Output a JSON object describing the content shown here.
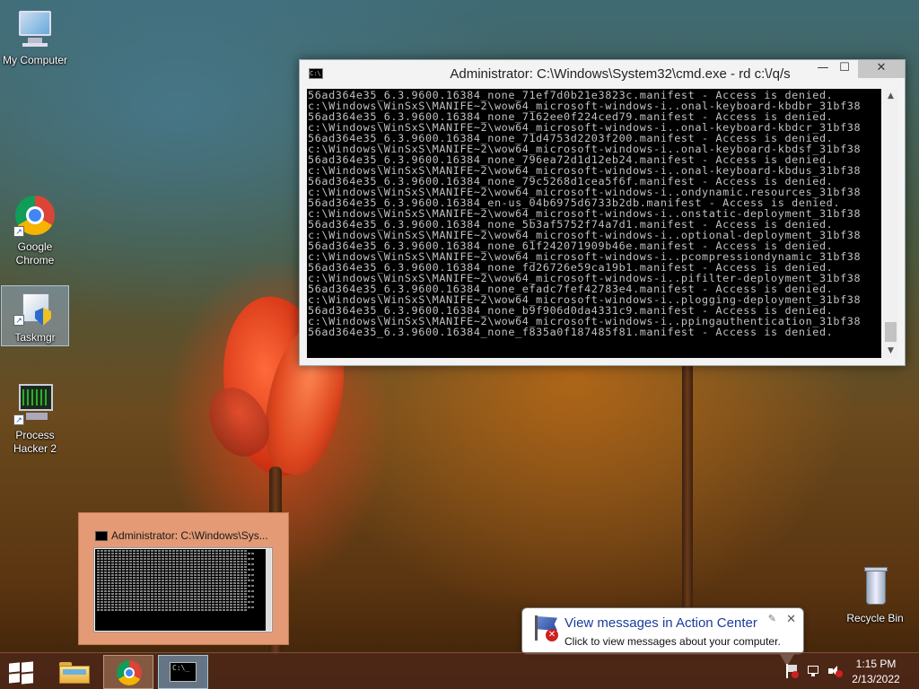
{
  "desktop": {
    "icons": [
      {
        "label": "My Computer",
        "icon": "computer-icon"
      },
      {
        "label": "Google Chrome",
        "icon": "chrome-icon"
      },
      {
        "label": "Taskmgr",
        "icon": "taskmgr-icon"
      },
      {
        "label": "Process Hacker 2",
        "icon": "process-hacker-icon"
      },
      {
        "label": "Recycle Bin",
        "icon": "recycle-bin-icon"
      }
    ]
  },
  "cmd_window": {
    "title": "Administrator: C:\\Windows\\System32\\cmd.exe - rd  c:\\/q/s",
    "minimize": "—",
    "maximize": "☐",
    "close": "✕",
    "lines": [
      "56ad364e35_6.3.9600.16384_none_71ef7d0b21e3823c.manifest - Access is denied.",
      "c:\\Windows\\WinSxS\\MANIFE~2\\wow64_microsoft-windows-i..onal-keyboard-kbdbr_31bf38",
      "56ad364e35_6.3.9600.16384_none_7162ee0f224ced79.manifest - Access is denied.",
      "c:\\Windows\\WinSxS\\MANIFE~2\\wow64_microsoft-windows-i..onal-keyboard-kbdcr_31bf38",
      "56ad364e35_6.3.9600.16384_none_71d4753d2203f200.manifest - Access is denied.",
      "c:\\Windows\\WinSxS\\MANIFE~2\\wow64_microsoft-windows-i..onal-keyboard-kbdsf_31bf38",
      "56ad364e35_6.3.9600.16384_none_796ea72d1d12eb24.manifest - Access is denied.",
      "c:\\Windows\\WinSxS\\MANIFE~2\\wow64_microsoft-windows-i..onal-keyboard-kbdus_31bf38",
      "56ad364e35_6.3.9600.16384_none_79c5268d1cea5f6f.manifest - Access is denied.",
      "c:\\Windows\\WinSxS\\MANIFE~2\\wow64_microsoft-windows-i..ondynamic.resources_31bf38",
      "56ad364e35_6.3.9600.16384_en-us_04b6975d6733b2db.manifest - Access is denied.",
      "c:\\Windows\\WinSxS\\MANIFE~2\\wow64_microsoft-windows-i..onstatic-deployment_31bf38",
      "56ad364e35_6.3.9600.16384_none_5b3af5752f74a7d1.manifest - Access is denied.",
      "c:\\Windows\\WinSxS\\MANIFE~2\\wow64_microsoft-windows-i..optional-deployment_31bf38",
      "56ad364e35_6.3.9600.16384_none_61f242071909b46e.manifest - Access is denied.",
      "c:\\Windows\\WinSxS\\MANIFE~2\\wow64_microsoft-windows-i..pcompressiondynamic_31bf38",
      "56ad364e35_6.3.9600.16384_none_fd26726e59ca19b1.manifest - Access is denied.",
      "c:\\Windows\\WinSxS\\MANIFE~2\\wow64_microsoft-windows-i..pifilter-deployment_31bf38",
      "56ad364e35_6.3.9600.16384_none_efadc7fef42783e4.manifest - Access is denied.",
      "c:\\Windows\\WinSxS\\MANIFE~2\\wow64_microsoft-windows-i..plogging-deployment_31bf38",
      "56ad364e35_6.3.9600.16384_none_b9f906d0da4331c9.manifest - Access is denied.",
      "c:\\Windows\\WinSxS\\MANIFE~2\\wow64_microsoft-windows-i..ppingauthentication_31bf38",
      "56ad364e35_6.3.9600.16384_none_f835a0f187485f81.manifest - Access is denied."
    ]
  },
  "thumbnail": {
    "title": "Administrator: C:\\Windows\\Sys..."
  },
  "notification": {
    "title": "View messages in Action Center",
    "body": "Click to view messages about your computer.",
    "close": "✕",
    "options": "✎"
  },
  "taskbar": {
    "items": [
      "start",
      "file-explorer",
      "chrome",
      "cmd"
    ],
    "clock_time": "1:15 PM",
    "clock_date": "2/13/2022"
  },
  "colors": {
    "console_bg": "#000000",
    "console_fg": "#c0c0c0",
    "notification_title": "#1a3d9a"
  }
}
